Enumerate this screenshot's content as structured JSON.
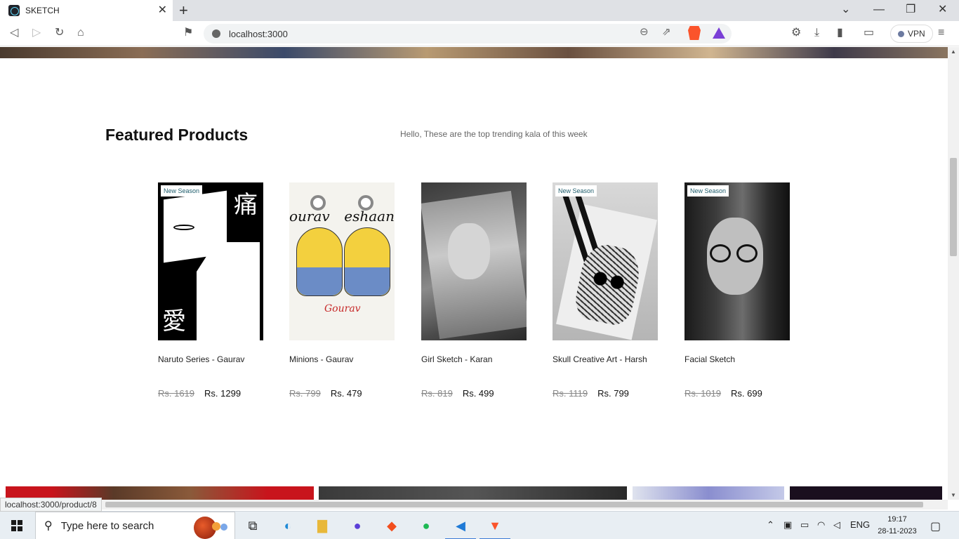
{
  "browser": {
    "tab_title": "SKETCH",
    "url": "localhost:3000",
    "vpn_label": "VPN",
    "status_url": "localhost:3000/product/8"
  },
  "section": {
    "title": "Featured Products",
    "subtitle": "Hello, These are the top trending kala of this week"
  },
  "products": [
    {
      "name": "Naruto Series - Gaurav",
      "old_price": "Rs. 1619",
      "price": "Rs. 1299",
      "badge": "New Season"
    },
    {
      "name": "Minions - Gaurav",
      "old_price": "Rs. 799",
      "price": "Rs. 479",
      "badge": "",
      "art_text_left": "ourav",
      "art_text_right": "eshaan",
      "art_signature": "Gourav"
    },
    {
      "name": "Girl Sketch - Karan",
      "old_price": "Rs. 819",
      "price": "Rs. 499",
      "badge": ""
    },
    {
      "name": "Skull Creative Art - Harsh",
      "old_price": "Rs. 1119",
      "price": "Rs. 799",
      "badge": "New Season"
    },
    {
      "name": "Facial Sketch",
      "old_price": "Rs. 1019",
      "price": "Rs. 699",
      "badge": "New Season"
    }
  ],
  "naruto_art": {
    "kanji_top": "痛",
    "kanji_bottom": "愛"
  },
  "taskbar": {
    "search_placeholder": "Type here to search",
    "language": "ENG",
    "time": "19:17",
    "date": "28-11-2023"
  },
  "colors": {
    "accent": "#3b7bd6",
    "badge_text": "#1d5c6b",
    "brave": "#fb542b"
  }
}
